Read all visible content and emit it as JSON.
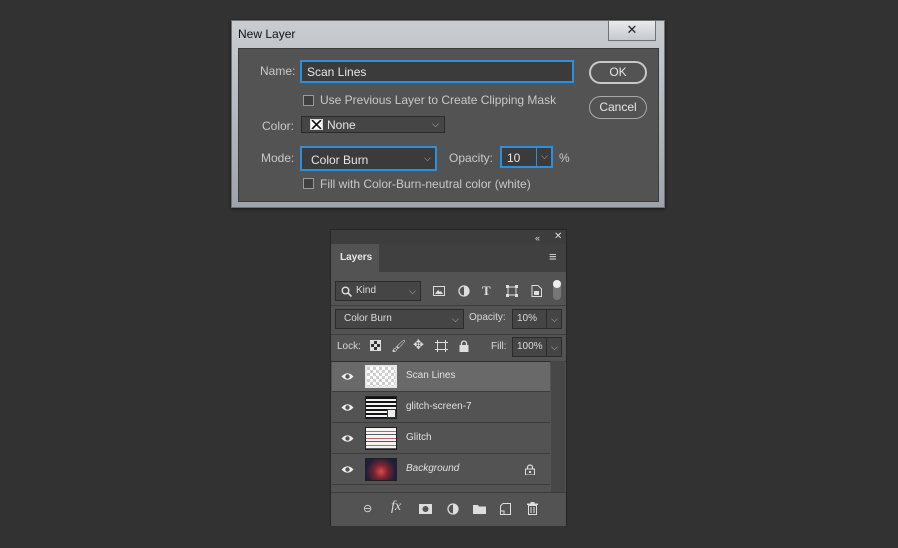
{
  "dialog": {
    "title": "New Layer",
    "close_label": "✕",
    "name_label": "Name:",
    "name_value": "Scan Lines",
    "clipping_mask_label": "Use Previous Layer to Create Clipping Mask",
    "color_label": "Color:",
    "color_value": "None",
    "mode_label": "Mode:",
    "mode_value": "Color Burn",
    "opacity_label": "Opacity:",
    "opacity_value": "10",
    "percent": "%",
    "fill_neutral_label": "Fill with Color-Burn-neutral color (white)",
    "ok_label": "OK",
    "cancel_label": "Cancel"
  },
  "layers_panel": {
    "tab_label": "Layers",
    "filter_kind": "Kind",
    "blend_mode": "Color Burn",
    "opacity_label": "Opacity:",
    "opacity_value": "10%",
    "lock_label": "Lock:",
    "fill_label": "Fill:",
    "fill_value": "100%",
    "layers": [
      {
        "name": "Scan Lines",
        "selected": true,
        "visible": true
      },
      {
        "name": "glitch-screen-7",
        "selected": false,
        "visible": true
      },
      {
        "name": "Glitch",
        "selected": false,
        "visible": true
      },
      {
        "name": "Background",
        "selected": false,
        "visible": true,
        "locked": true
      }
    ]
  },
  "colors": {
    "background": "#323232",
    "accent_focus": "#2e8fdd",
    "panel": "#535353"
  }
}
